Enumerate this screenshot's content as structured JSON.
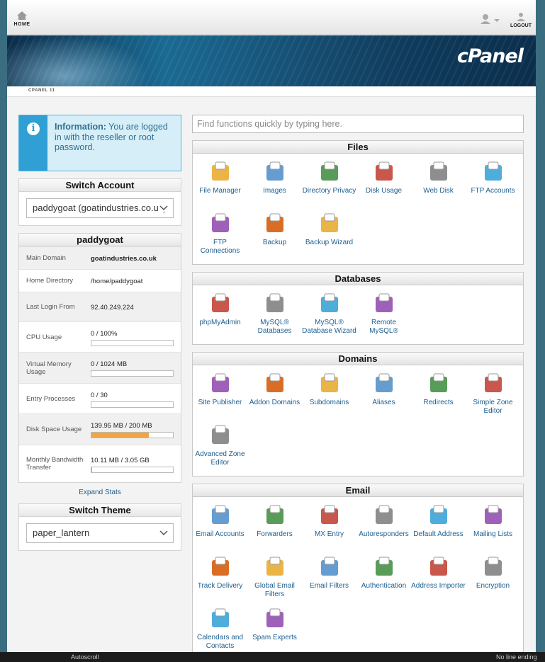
{
  "header": {
    "home_label": "HOME",
    "logout_label": "LOGOUT",
    "brand": "cPanel",
    "version": "CPANEL 11"
  },
  "info": {
    "title": "Information:",
    "message": "You are logged in with the reseller or root password."
  },
  "switch_account": {
    "title": "Switch Account",
    "selected": "paddygoat (goatindustries.co.uk)"
  },
  "stats": {
    "title": "paddygoat",
    "rows": [
      {
        "label": "Main Domain",
        "value": "goatindustries.co.uk"
      },
      {
        "label": "Home Directory",
        "value": "/home/paddygoat"
      },
      {
        "label": "Last Login From",
        "value": "92.40.249.224"
      },
      {
        "label": "CPU Usage",
        "value": "0 / 100%",
        "fraction": 0.0
      },
      {
        "label": "Virtual Memory Usage",
        "value": "0 / 1024 MB",
        "fraction": 0.0
      },
      {
        "label": "Entry Processes",
        "value": "0 / 30",
        "fraction": 0.0
      },
      {
        "label": "Disk Space Usage",
        "value": "139.95 MB / 200 MB",
        "fraction": 0.7
      },
      {
        "label": "Monthly Bandwidth Transfer",
        "value": "10.11 MB / 3.05 GB",
        "fraction": 0.003
      }
    ],
    "expand_label": "Expand Stats"
  },
  "switch_theme": {
    "title": "Switch Theme",
    "selected": "paper_lantern"
  },
  "search": {
    "placeholder": "Find functions quickly by typing here."
  },
  "groups": [
    {
      "title": "Files",
      "items": [
        "File Manager",
        "Images",
        "Directory Privacy",
        "Disk Usage",
        "Web Disk",
        "FTP Accounts",
        "FTP Connections",
        "Backup",
        "Backup Wizard"
      ]
    },
    {
      "title": "Databases",
      "items": [
        "phpMyAdmin",
        "MySQL® Databases",
        "MySQL® Database Wizard",
        "Remote MySQL®"
      ]
    },
    {
      "title": "Domains",
      "items": [
        "Site Publisher",
        "Addon Domains",
        "Subdomains",
        "Aliases",
        "Redirects",
        "Simple Zone Editor",
        "Advanced Zone Editor"
      ]
    },
    {
      "title": "Email",
      "items": [
        "Email Accounts",
        "Forwarders",
        "MX Entry",
        "Autoresponders",
        "Default Address",
        "Mailing Lists",
        "Track Delivery",
        "Global Email Filters",
        "Email Filters",
        "Authentication",
        "Address Importer",
        "Encryption",
        "Calendars and Contacts",
        "Spam Experts"
      ]
    }
  ],
  "taskbar": {
    "item1": "Autoscroll",
    "item2": "No line ending"
  },
  "colors": {
    "accent_blue": "#2f9fd4",
    "disk_bar": "#f0a540",
    "link": "#1d5e8e"
  }
}
